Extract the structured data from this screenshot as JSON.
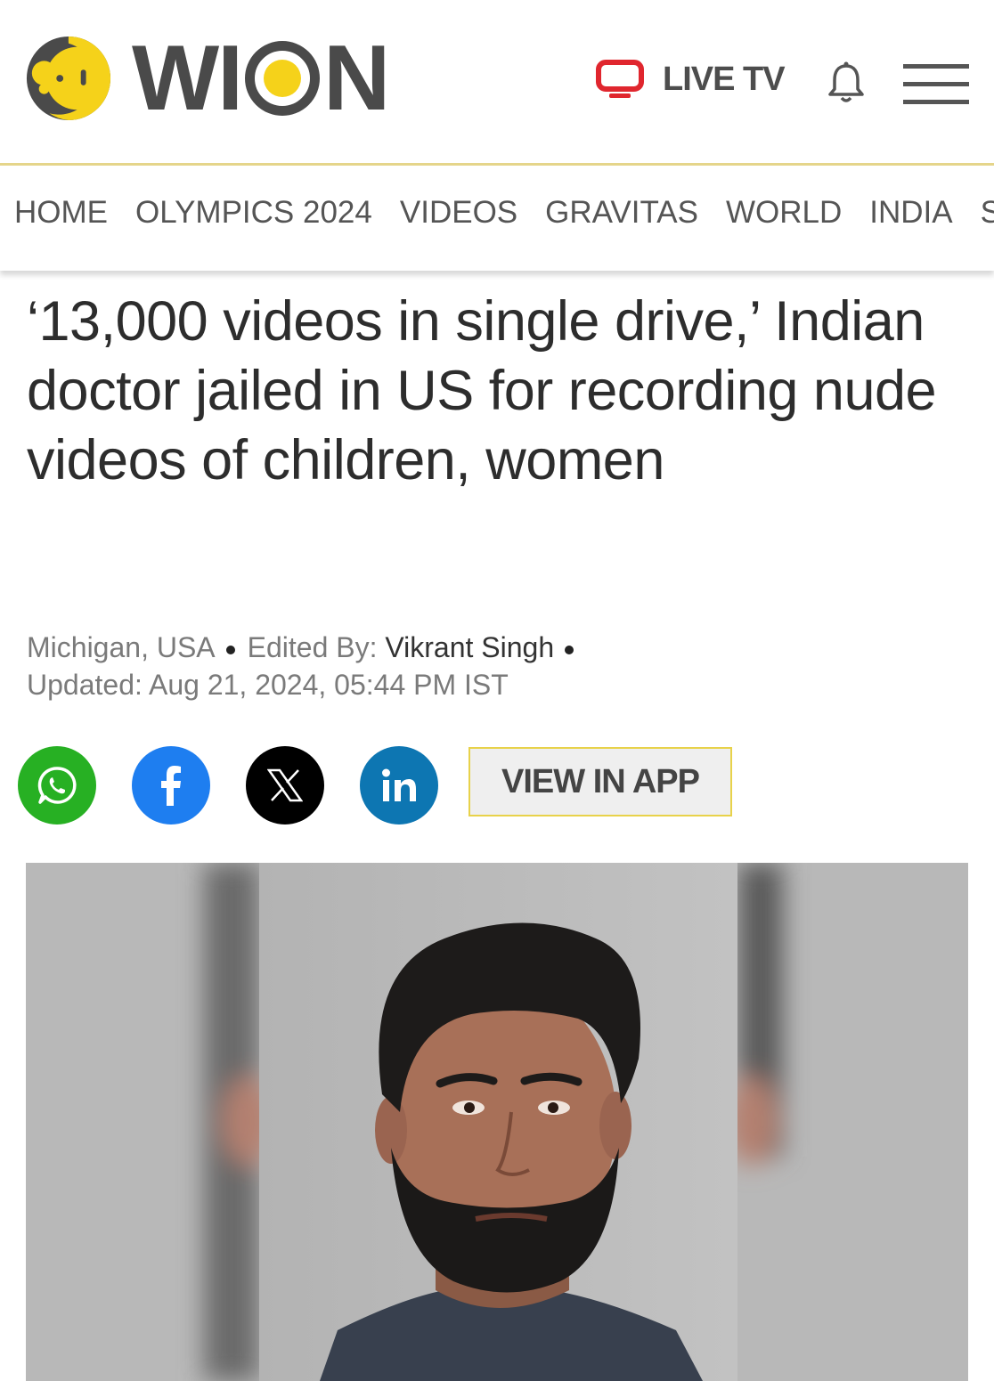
{
  "header": {
    "logo_text": "WION",
    "live_label": "LIVE TV",
    "icons": {
      "logo": "wion-logo-icon",
      "live": "tv-icon",
      "notifications": "bell-icon",
      "menu": "hamburger-menu-icon"
    },
    "colors": {
      "brand_yellow": "#f5d21a",
      "logo_gray": "#4a4a4a",
      "live_red": "#e0262e",
      "nav_divider": "#e5d58a"
    }
  },
  "nav": {
    "items": [
      {
        "label": "HOME"
      },
      {
        "label": "OLYMPICS 2024"
      },
      {
        "label": "VIDEOS"
      },
      {
        "label": "GRAVITAS"
      },
      {
        "label": "WORLD"
      },
      {
        "label": "INDIA"
      },
      {
        "label": "S"
      }
    ]
  },
  "article": {
    "headline": "‘13,000 videos in single drive,’ Indian doctor jailed in US for recording nude videos of children, women",
    "location": "Michigan, USA",
    "edited_by_label": "Edited By:",
    "editor": "Vikrant Singh",
    "updated": "Updated: Aug 21, 2024, 05:44 PM IST"
  },
  "share": {
    "buttons": [
      {
        "icon": "whatsapp-icon",
        "color": "#27b023"
      },
      {
        "icon": "facebook-icon",
        "color": "#1e7ef0"
      },
      {
        "icon": "x-icon",
        "color": "#000000"
      },
      {
        "icon": "linkedin-icon",
        "color": "#0d76b2"
      }
    ],
    "app_button_label": "VIEW IN APP"
  }
}
